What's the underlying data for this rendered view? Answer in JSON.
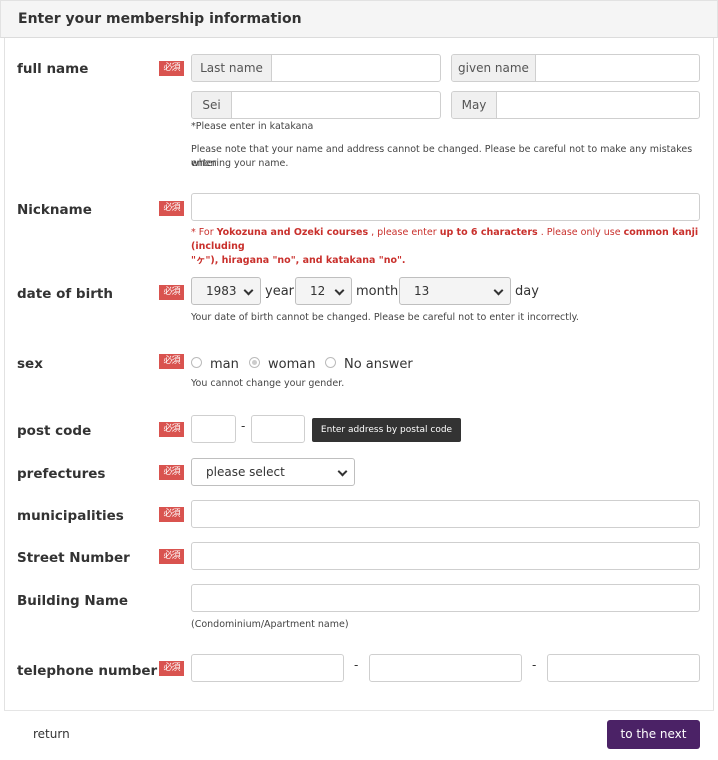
{
  "header": {
    "title": "Enter your membership information"
  },
  "required_badge": "必須",
  "fields": {
    "full_name": {
      "label": "full name",
      "last_name_addon": "Last name",
      "given_name_addon": "given name",
      "sei_addon": "Sei",
      "may_addon": "May",
      "katakana_note": "*Please enter in katakana",
      "change_note_1": "Please note that your name and address cannot be changed. Please be careful not to make any mistakes when",
      "change_note_2": "entering your name."
    },
    "nickname": {
      "label": "Nickname",
      "warn_a": "* For ",
      "warn_b": "Yokozuna and Ozeki courses",
      "warn_c": " , please enter ",
      "warn_d": "up to 6 characters",
      "warn_e": " . Please only use ",
      "warn_f": "common kanji (including",
      "warn_g": "\"ヶ\"), hiragana \"no\", and katakana \"no\".",
      "warn_h": ""
    },
    "dob": {
      "label": "date of birth",
      "year_value": "1983",
      "year_text": "year",
      "month_value": "12",
      "month_text": "month",
      "day_value": "13",
      "day_text": "day",
      "note": "Your date of birth cannot be changed. Please be careful not to enter it incorrectly."
    },
    "sex": {
      "label": "sex",
      "options": [
        "man",
        "woman",
        "No answer"
      ],
      "note": "You cannot change your gender."
    },
    "post_code": {
      "label": "post code",
      "dash": "-",
      "button": "Enter address by postal code"
    },
    "prefectures": {
      "label": "prefectures",
      "value": "please select"
    },
    "municipalities": {
      "label": "municipalities"
    },
    "street": {
      "label": "Street Number"
    },
    "building": {
      "label": "Building Name",
      "note": "(Condominium/Apartment name)"
    },
    "telephone": {
      "label": "telephone number",
      "dash": "-"
    }
  },
  "footer": {
    "return": "return",
    "next": "to the next"
  }
}
